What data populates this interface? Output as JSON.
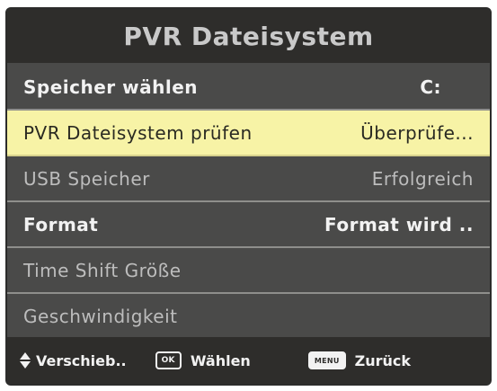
{
  "title": "PVR Dateisystem",
  "rows": [
    {
      "label": "Speicher wählen",
      "value": "C:"
    },
    {
      "label": "PVR Dateisystem prüfen",
      "value": "Überprüfe..."
    },
    {
      "label": "USB Speicher",
      "value": "Erfolgreich"
    },
    {
      "label": "Format",
      "value": "Format wird .."
    },
    {
      "label": "Time Shift Größe",
      "value": ""
    },
    {
      "label": "Geschwindigkeit",
      "value": ""
    }
  ],
  "footer": {
    "move_label": "Verschieb..",
    "ok_key": "OK",
    "ok_label": "Wählen",
    "menu_key": "MENU",
    "back_label": "Zurück"
  },
  "colors": {
    "background": "#4a4a49",
    "header": "#2e2d2b",
    "highlight": "#f7f3a6"
  }
}
